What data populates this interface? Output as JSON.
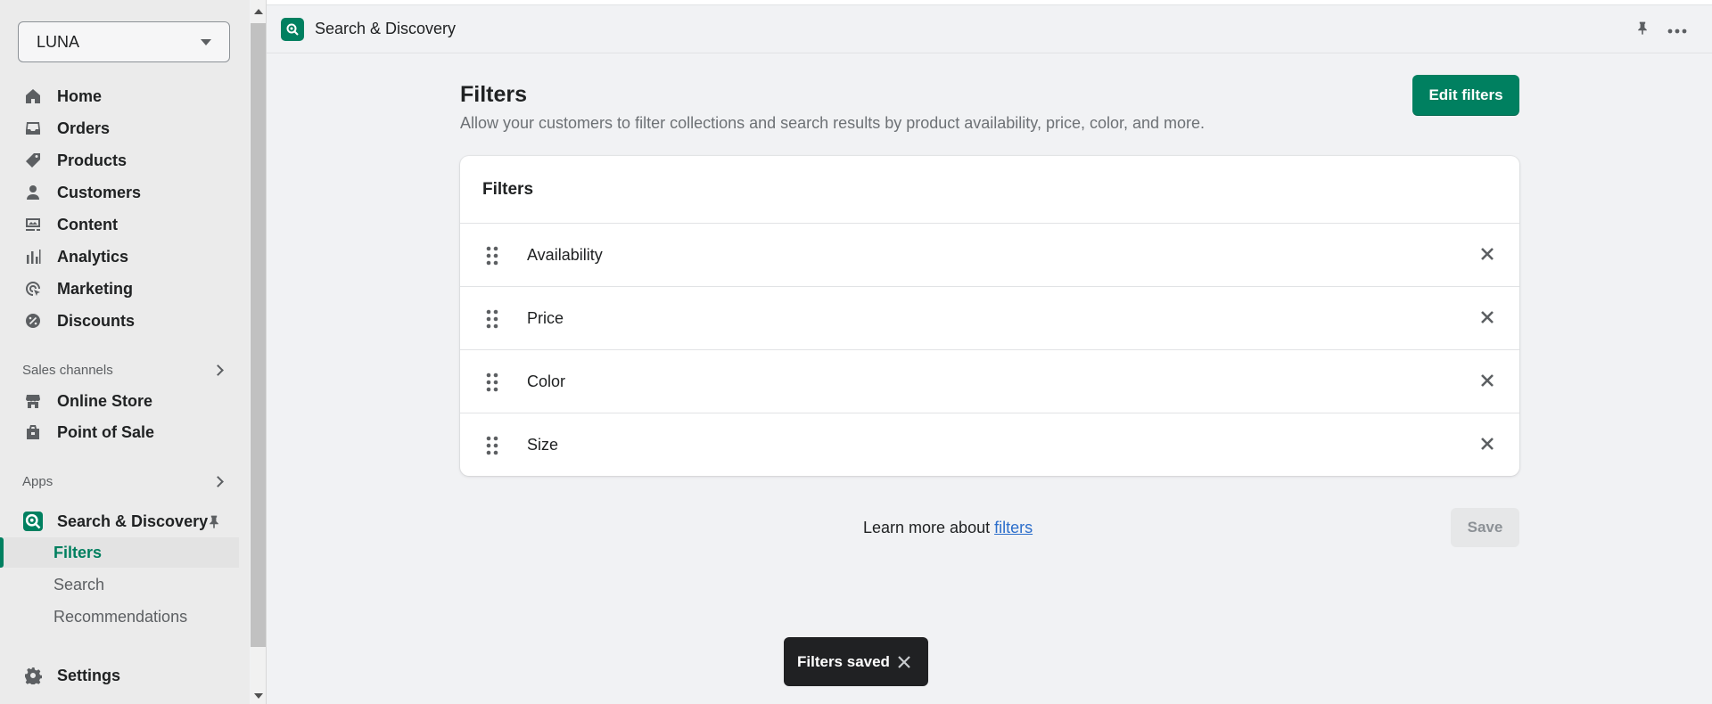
{
  "sidebar": {
    "store_name": "LUNA",
    "nav": [
      {
        "label": "Home",
        "icon": "home-icon"
      },
      {
        "label": "Orders",
        "icon": "inbox-icon"
      },
      {
        "label": "Products",
        "icon": "tag-icon"
      },
      {
        "label": "Customers",
        "icon": "person-icon"
      },
      {
        "label": "Content",
        "icon": "image-icon"
      },
      {
        "label": "Analytics",
        "icon": "bar-chart-icon"
      },
      {
        "label": "Marketing",
        "icon": "target-icon"
      },
      {
        "label": "Discounts",
        "icon": "discount-icon"
      }
    ],
    "sales_channels_label": "Sales channels",
    "sales_channels": [
      {
        "label": "Online Store",
        "icon": "store-icon"
      },
      {
        "label": "Point of Sale",
        "icon": "shopping-bag-icon"
      }
    ],
    "apps_label": "Apps",
    "app": {
      "label": "Search & Discovery",
      "icon": "search-discovery-icon"
    },
    "app_subitems": [
      {
        "label": "Filters",
        "active": true
      },
      {
        "label": "Search",
        "active": false
      },
      {
        "label": "Recommendations",
        "active": false
      }
    ],
    "settings_label": "Settings"
  },
  "topbar": {
    "title": "Search & Discovery"
  },
  "page": {
    "title": "Filters",
    "subtitle": "Allow your customers to filter collections and search results by product availability, price, color, and more.",
    "edit_button": "Edit filters"
  },
  "card": {
    "title": "Filters",
    "filters": [
      "Availability",
      "Price",
      "Color",
      "Size"
    ]
  },
  "footer": {
    "learn_prefix": "Learn more about ",
    "learn_link": "filters",
    "save_label": "Save"
  },
  "toast": {
    "message": "Filters saved"
  },
  "colors": {
    "primary": "#008060",
    "link": "#2c6ecb",
    "toast_bg": "#202123"
  }
}
